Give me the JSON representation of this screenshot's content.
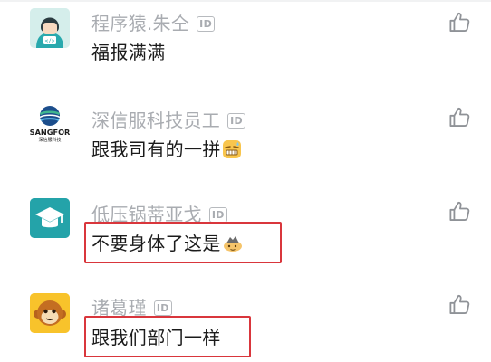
{
  "comments": [
    {
      "username": "程序猿.朱仝",
      "id_badge": "ID",
      "text": "福报满满"
    },
    {
      "username": "深信服科技员工",
      "id_badge": "ID",
      "text": "跟我司有的一拼",
      "avatar_logo": "SANGFOR",
      "avatar_subtitle": "深信服科技",
      "emoji": "grinning-sweat-emoji"
    },
    {
      "username": "低压锅蒂亚戈",
      "id_badge": "ID",
      "text": "不要身体了这是",
      "emoji": "fainting-emoji",
      "highlighted": true
    },
    {
      "username": "诸葛瑾",
      "id_badge": "ID",
      "text": "跟我们部门一样",
      "highlighted": true
    }
  ],
  "icons": {
    "like": "thumbs-up-outline-icon"
  },
  "colors": {
    "username": "#a9acb1",
    "text": "#1b1b1b",
    "highlight": "#d9363c",
    "avatar_teal": "#24a3a9",
    "avatar_mint": "#d5eeeb"
  }
}
